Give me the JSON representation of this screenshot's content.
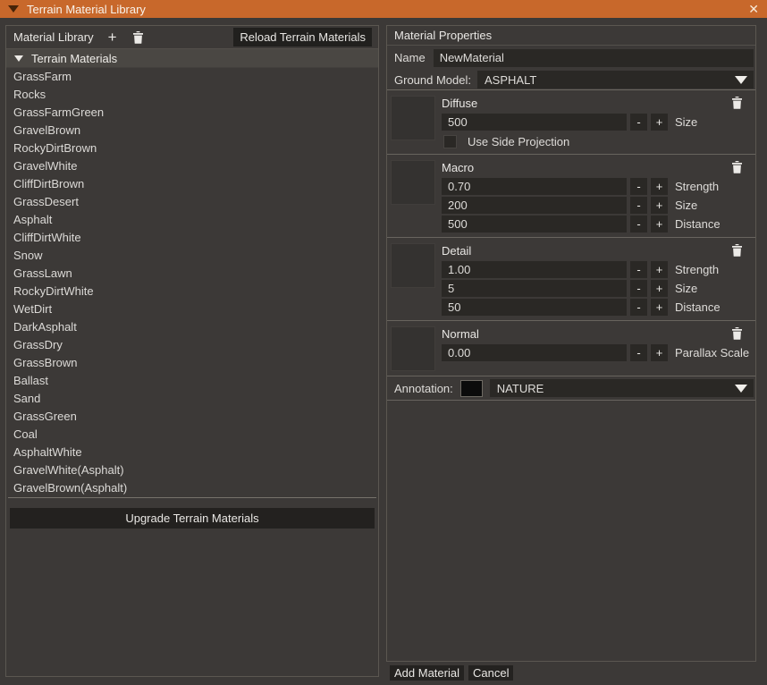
{
  "window": {
    "title": "Terrain Material Library",
    "close_glyph": "✕"
  },
  "left_panel": {
    "header": "Material Library",
    "add_glyph": "+",
    "reload_button": "Reload Terrain Materials",
    "tree_root": "Terrain Materials",
    "materials": [
      "GrassFarm",
      "Rocks",
      "GrassFarmGreen",
      "GravelBrown",
      "RockyDirtBrown",
      "GravelWhite",
      "CliffDirtBrown",
      "GrassDesert",
      "Asphalt",
      "CliffDirtWhite",
      "Snow",
      "GrassLawn",
      "RockyDirtWhite",
      "WetDirt",
      "DarkAsphalt",
      "GrassDry",
      "GrassBrown",
      "Ballast",
      "Sand",
      "GrassGreen",
      "Coal",
      "AsphaltWhite",
      "GravelWhite(Asphalt)",
      "GravelBrown(Asphalt)"
    ],
    "upgrade_button": "Upgrade Terrain Materials"
  },
  "right_panel": {
    "header": "Material Properties",
    "name_label": "Name",
    "name_value": "NewMaterial",
    "ground_model_label": "Ground Model:",
    "ground_model_value": "ASPHALT",
    "minus_label": "-",
    "plus_label": "+",
    "sections": [
      {
        "title": "Diffuse",
        "rows": [
          {
            "value": "500",
            "label": "Size"
          }
        ],
        "checkbox_label": "Use Side Projection"
      },
      {
        "title": "Macro",
        "rows": [
          {
            "value": "0.70",
            "label": "Strength"
          },
          {
            "value": "200",
            "label": "Size"
          },
          {
            "value": "500",
            "label": "Distance"
          }
        ]
      },
      {
        "title": "Detail",
        "rows": [
          {
            "value": "1.00",
            "label": "Strength"
          },
          {
            "value": "5",
            "label": "Size"
          },
          {
            "value": "50",
            "label": "Distance"
          }
        ]
      },
      {
        "title": "Normal",
        "rows": [
          {
            "value": "0.00",
            "label": "Parallax Scale"
          }
        ]
      }
    ],
    "annotation_label": "Annotation:",
    "annotation_value": "NATURE",
    "annotation_swatch_color": "#0b0b0b",
    "add_button": "Add Material",
    "cancel_button": "Cancel"
  },
  "colors": {
    "titlebar_accent": "#c8682b",
    "window_background": "#3c3937",
    "input_background": "#2a2825",
    "button_background": "#21201e",
    "tree_header_background": "#4a4743",
    "text": "#e9e7e4"
  }
}
